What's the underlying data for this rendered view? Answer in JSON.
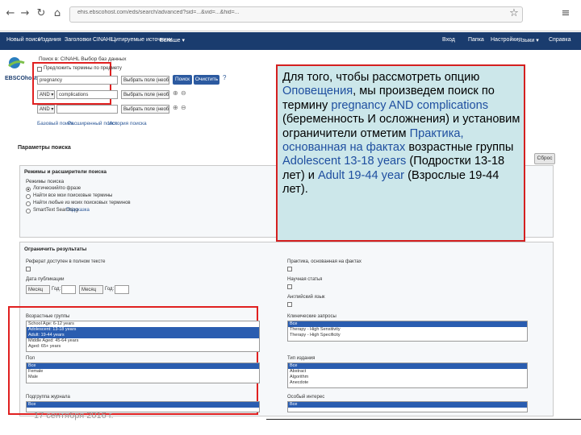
{
  "browser": {
    "nav_icons": [
      "back-icon",
      "forward-icon",
      "reload-icon",
      "home-icon"
    ],
    "url": "ehis.ebscohost.com/eds/search/advanced?sid=...&vid=...&hid=...",
    "star_icon": "☆",
    "menu_icon": "≡"
  },
  "toolbar": {
    "left_items": [
      "Новый поиск",
      "Издания",
      "Заголовки CINAHL",
      "Цитируемые источники",
      "Больше ▾"
    ],
    "right_items": [
      "Вход",
      "Папка",
      "Настройки",
      "Языки ▾",
      "Справка"
    ]
  },
  "logo": {
    "text": "EBSCOhost"
  },
  "search": {
    "breadcrumb": "Поиск в: CINAHL Выбор баз данных",
    "row1": {
      "field_value": "pregnancy",
      "field_select": "Выбрать поле (необ...▾"
    },
    "row2": {
      "op": "AND ▾",
      "field_value": "complications",
      "field_select": "Выбрать поле (необ...▾"
    },
    "row3": {
      "op": "AND ▾",
      "field_value": "",
      "field_select": "Выбрать поле (необ...▾"
    },
    "search_button": "Поиск",
    "clear_button": "Очистить",
    "links": [
      "Базовый поиск",
      "Расширенный поиск",
      "История поиска"
    ],
    "suggest_checkbox_label": "Предложить термины по предмету"
  },
  "options": {
    "title": "Параметры поиска",
    "reset_button": "Сброс",
    "modes_header": "Режимы и расширители поиска",
    "modes_label": "Режимы поиска",
    "modes": [
      {
        "label": "Логический/по фразе",
        "selected": true
      },
      {
        "label": "Найти все мои поисковые термины",
        "selected": false
      },
      {
        "label": "Найти любые из моих поисковых терминов",
        "selected": false
      },
      {
        "label": "SmartText Searching",
        "selected": false
      }
    ],
    "smarttext_hint": "Подсказка"
  },
  "limits": {
    "header": "Ограничить результаты",
    "left": {
      "full_text_label": "Реферат доступен в полном тексте",
      "pub_date_label": "Дата публикации",
      "month_from": "Месяц",
      "year_from_label": "Год:",
      "month_to": "Месяц",
      "year_to_label": "Год:",
      "age_label": "Возрастные группы",
      "age_options": [
        "School Age: 6-12 years",
        "Adolescent: 13-18 years",
        "Adult: 19-44 years",
        "Middle Aged: 45-64 years",
        "Aged: 65+ years"
      ],
      "age_selected": [
        1,
        2
      ],
      "sex_label": "Пол",
      "sex_options": [
        "Все",
        "Female",
        "Male"
      ],
      "sex_selected": [
        0
      ],
      "pubtype_label": "Подгруппа журнала",
      "pubtype_options": [
        "Все"
      ],
      "pubtype_selected": [
        0
      ]
    },
    "right": {
      "evidence_label": "Практика, основанная на фактах",
      "peer_label": "Научная статья",
      "english_label": "Английский язык",
      "clinical_label": "Клинические запросы",
      "clinical_options": [
        "Все",
        "Therapy - High Sensitivity",
        "Therapy - High Specificity"
      ],
      "clinical_selected": [
        0
      ],
      "category_label": "Тип издания",
      "category_options": [
        "Все",
        "Abstract",
        "Algorithm",
        "Anecdote"
      ],
      "category_selected": [
        0
      ],
      "special_label": "Особый интерес",
      "special_options": [
        "Все"
      ],
      "special_selected": [
        0
      ]
    }
  },
  "callout": {
    "part1": "Для того, чтобы рассмотреть опцию ",
    "part2": "Оповещения",
    "part3": ", мы произведем поиск по термину ",
    "part4": "pregnancy AND complications",
    "part5": " (беременность И осложнения) и установим ограничители отметим ",
    "part6": "Практика, основанная на фактах",
    "part7": " возрастные группы ",
    "part8": "Adolescent 13-18 years",
    "part9": " (Подростки 13-18 лет)  и ",
    "part10": "Adult 19-44 year",
    "part11": " (Взрослые 19-44 лет)."
  },
  "footer": {
    "date": "17 сентября 2016 г."
  },
  "colors": {
    "toolbar": "#1a3c6e",
    "highlight": "#2a5db0",
    "callout_bg": "#cce7ea",
    "red": "#e02020"
  }
}
